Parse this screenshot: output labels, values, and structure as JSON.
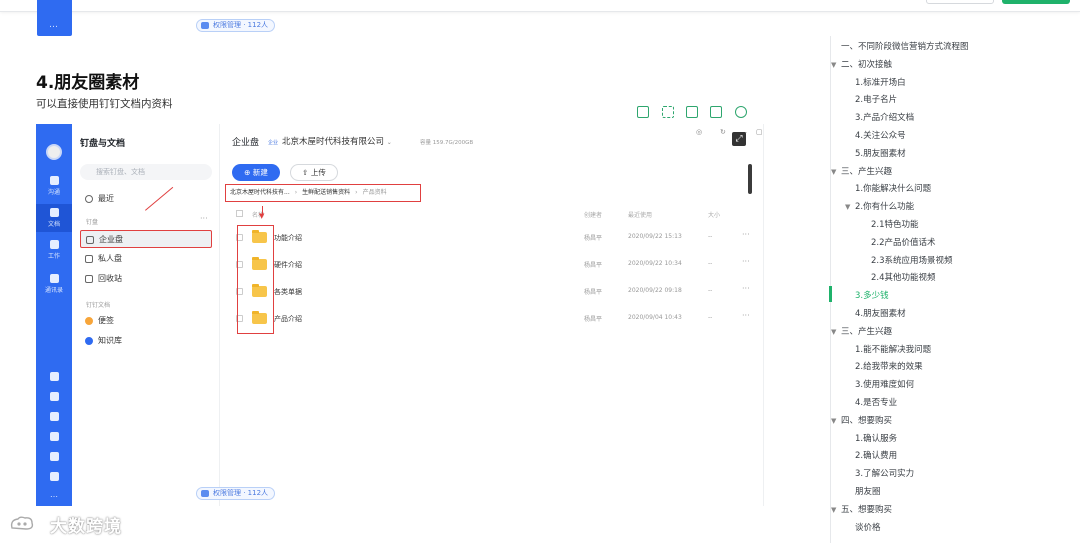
{
  "top_stub_label": "…",
  "badges": {
    "top": "权限管理 · 112人",
    "bottom": "权限管理 · 112人"
  },
  "section": {
    "title": "4.朋友圈素材",
    "subtitle": "可以直接使用钉钉文档内资料"
  },
  "app": {
    "rail": {
      "items": [
        "沟通",
        "文档",
        "工作",
        "通讯录"
      ],
      "more": "…"
    },
    "sidebar": {
      "title": "钉盘与文档",
      "search_placeholder": "搜索钉盘、文档",
      "recent": "最近",
      "group_label": "钉盘",
      "enterprise": "企业盘",
      "personal": "私人盘",
      "recycle": "回收站",
      "docs_label": "钉钉文档",
      "notes": "便签",
      "knowledge": "知识库",
      "more": "···"
    },
    "main": {
      "title": "企业盘",
      "org_tag": "企业",
      "org": "北京木屋时代科技有限公司",
      "capacity": "容量 159.7G/200GB",
      "new_button": "新建",
      "upload_button": "上传",
      "breadcrumb": [
        "北京木屋时代科技有...",
        "生鲜配送销售资料",
        "产品资料"
      ],
      "columns": {
        "name": "名称",
        "creator": "创建者",
        "recent": "最近使用",
        "size": "大小"
      },
      "rows": [
        {
          "name": "功能介绍",
          "creator": "杨昌平",
          "date": "2020/09/22 15:13",
          "size": "--",
          "more": "···"
        },
        {
          "name": "硬件介绍",
          "creator": "杨昌平",
          "date": "2020/09/22 10:34",
          "size": "--",
          "more": "···"
        },
        {
          "name": "各类单据",
          "creator": "杨昌平",
          "date": "2020/09/22 09:18",
          "size": "--",
          "more": "···"
        },
        {
          "name": "产品介绍",
          "creator": "杨昌平",
          "date": "2020/09/04 10:43",
          "size": "--",
          "more": "···"
        }
      ]
    }
  },
  "toc": [
    {
      "text": "一、不同阶段微信营销方式流程图",
      "level": 0,
      "toggle": ""
    },
    {
      "text": "二、初次接触",
      "level": 0,
      "toggle": "▼"
    },
    {
      "text": "1.标准开场白",
      "level": 1,
      "toggle": ""
    },
    {
      "text": "2.电子名片",
      "level": 1,
      "toggle": ""
    },
    {
      "text": "3.产品介绍文档",
      "level": 1,
      "toggle": ""
    },
    {
      "text": "4.关注公众号",
      "level": 1,
      "toggle": ""
    },
    {
      "text": "5.朋友圈素材",
      "level": 1,
      "toggle": ""
    },
    {
      "text": "三、产生兴趣",
      "level": 0,
      "toggle": "▼"
    },
    {
      "text": "1.你能解决什么问题",
      "level": 1,
      "toggle": ""
    },
    {
      "text": "2.你有什么功能",
      "level": 1,
      "toggle": "▼"
    },
    {
      "text": "2.1特色功能",
      "level": 2,
      "toggle": ""
    },
    {
      "text": "2.2产品价值话术",
      "level": 2,
      "toggle": ""
    },
    {
      "text": "2.3系统应用场景视频",
      "level": 2,
      "toggle": ""
    },
    {
      "text": "2.4其他功能视频",
      "level": 2,
      "toggle": ""
    },
    {
      "text": "3.多少钱",
      "level": 1,
      "toggle": "",
      "active": true
    },
    {
      "text": "4.朋友圈素材",
      "level": 1,
      "toggle": ""
    },
    {
      "text": "三、产生兴趣",
      "level": 0,
      "toggle": "▼"
    },
    {
      "text": "1.能不能解决我问题",
      "level": 1,
      "toggle": ""
    },
    {
      "text": "2.给我带来的效果",
      "level": 1,
      "toggle": ""
    },
    {
      "text": "3.使用难度如何",
      "level": 1,
      "toggle": ""
    },
    {
      "text": "4.是否专业",
      "level": 1,
      "toggle": ""
    },
    {
      "text": "四、想要购买",
      "level": 0,
      "toggle": "▼"
    },
    {
      "text": "1.确认服务",
      "level": 1,
      "toggle": ""
    },
    {
      "text": "2.确认费用",
      "level": 1,
      "toggle": ""
    },
    {
      "text": "3.了解公司实力",
      "level": 1,
      "toggle": ""
    },
    {
      "text": "朋友圈",
      "level": 1,
      "toggle": ""
    },
    {
      "text": "五、想要购买",
      "level": 0,
      "toggle": "▼"
    },
    {
      "text": "谈价格",
      "level": 1,
      "toggle": ""
    }
  ],
  "watermark": "大数跨境",
  "colors": {
    "rail_blue": "#2f6bf1",
    "accent_green": "#1fb26b",
    "annotation_red": "#e04040",
    "folder_yellow": "#f7c54a"
  }
}
